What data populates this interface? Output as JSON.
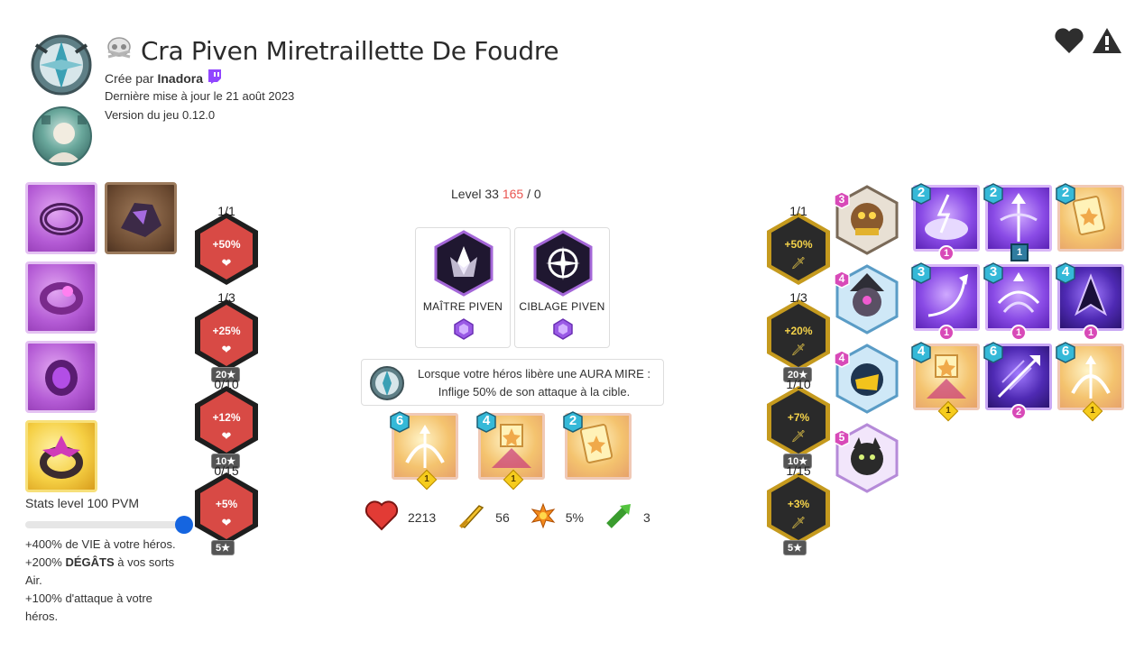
{
  "header": {
    "title": "Cra Piven Miretraillette De Foudre",
    "created_by_prefix": "Crée par",
    "author": "Inadora",
    "updated": "Dernière mise à jour le 21 août 2023",
    "version": "Version du jeu 0.12.0"
  },
  "left_runes": [
    {
      "count": "1/1",
      "value": "+50%",
      "icon": "heart-icon",
      "stars": ""
    },
    {
      "count": "1/3",
      "value": "+25%",
      "icon": "heart-icon",
      "stars": "20★"
    },
    {
      "count": "0/10",
      "value": "+12%",
      "icon": "heart-icon",
      "stars": "10★"
    },
    {
      "count": "0/15",
      "value": "+5%",
      "icon": "heart-icon",
      "stars": "5★"
    }
  ],
  "right_runes": [
    {
      "count": "1/1",
      "value": "+50%",
      "icon": "sword-icon",
      "stars": ""
    },
    {
      "count": "1/3",
      "value": "+20%",
      "icon": "sword-icon",
      "stars": "20★"
    },
    {
      "count": "1/10",
      "value": "+7%",
      "icon": "sword-icon",
      "stars": "10★"
    },
    {
      "count": "1/15",
      "value": "+3%",
      "icon": "sword-icon",
      "stars": "5★"
    }
  ],
  "stats_panel": {
    "title": "Stats level 100 PVM",
    "line1": "+400% de VIE à votre héros.",
    "line2_a": "+200% ",
    "line2_b": "DÉGÂTS",
    "line2_c": " à vos sorts",
    "line2_d": "Air.",
    "line3": "+100% d'attaque à votre",
    "line3_b": "héros."
  },
  "level": {
    "label": "Level 33",
    "current": "165",
    "sep": "/ 0"
  },
  "cards": [
    {
      "label": "MAÎTRE PIVEN"
    },
    {
      "label": "CIBLAGE PIVEN"
    }
  ],
  "description": {
    "line1": "Lorsque votre héros libère une AURA MIRE :",
    "line2": "Inflige 50% de son attaque à la cible."
  },
  "center_spells": [
    {
      "cost": "6",
      "level": "1"
    },
    {
      "cost": "4",
      "level": "1"
    },
    {
      "cost": "2",
      "level": ""
    }
  ],
  "summary": {
    "life": "2213",
    "attack": "56",
    "crit": "5%",
    "range": "3"
  },
  "companions": [
    {
      "cost": "3"
    },
    {
      "cost": "4"
    },
    {
      "cost": "4"
    },
    {
      "cost": "5"
    }
  ],
  "right_spells": [
    {
      "cost": "2",
      "badge": "1",
      "badge_type": "pink"
    },
    {
      "cost": "2",
      "badge": "1",
      "badge_type": "blue"
    },
    {
      "cost": "2",
      "badge": "",
      "badge_type": ""
    },
    {
      "cost": "3",
      "badge": "1",
      "badge_type": "pink"
    },
    {
      "cost": "3",
      "badge": "1",
      "badge_type": "pink"
    },
    {
      "cost": "4",
      "badge": "1",
      "badge_type": "pink"
    },
    {
      "cost": "4",
      "badge": "1",
      "badge_type": "yellow"
    },
    {
      "cost": "6",
      "badge": "2",
      "badge_type": "pink"
    },
    {
      "cost": "6",
      "badge": "1",
      "badge_type": "yellow"
    }
  ],
  "colors": {
    "red_rune": "#d84a45",
    "gold_rune": "#2a2a2a",
    "accent_blue": "#1565e0",
    "level_red": "#e9544f"
  }
}
